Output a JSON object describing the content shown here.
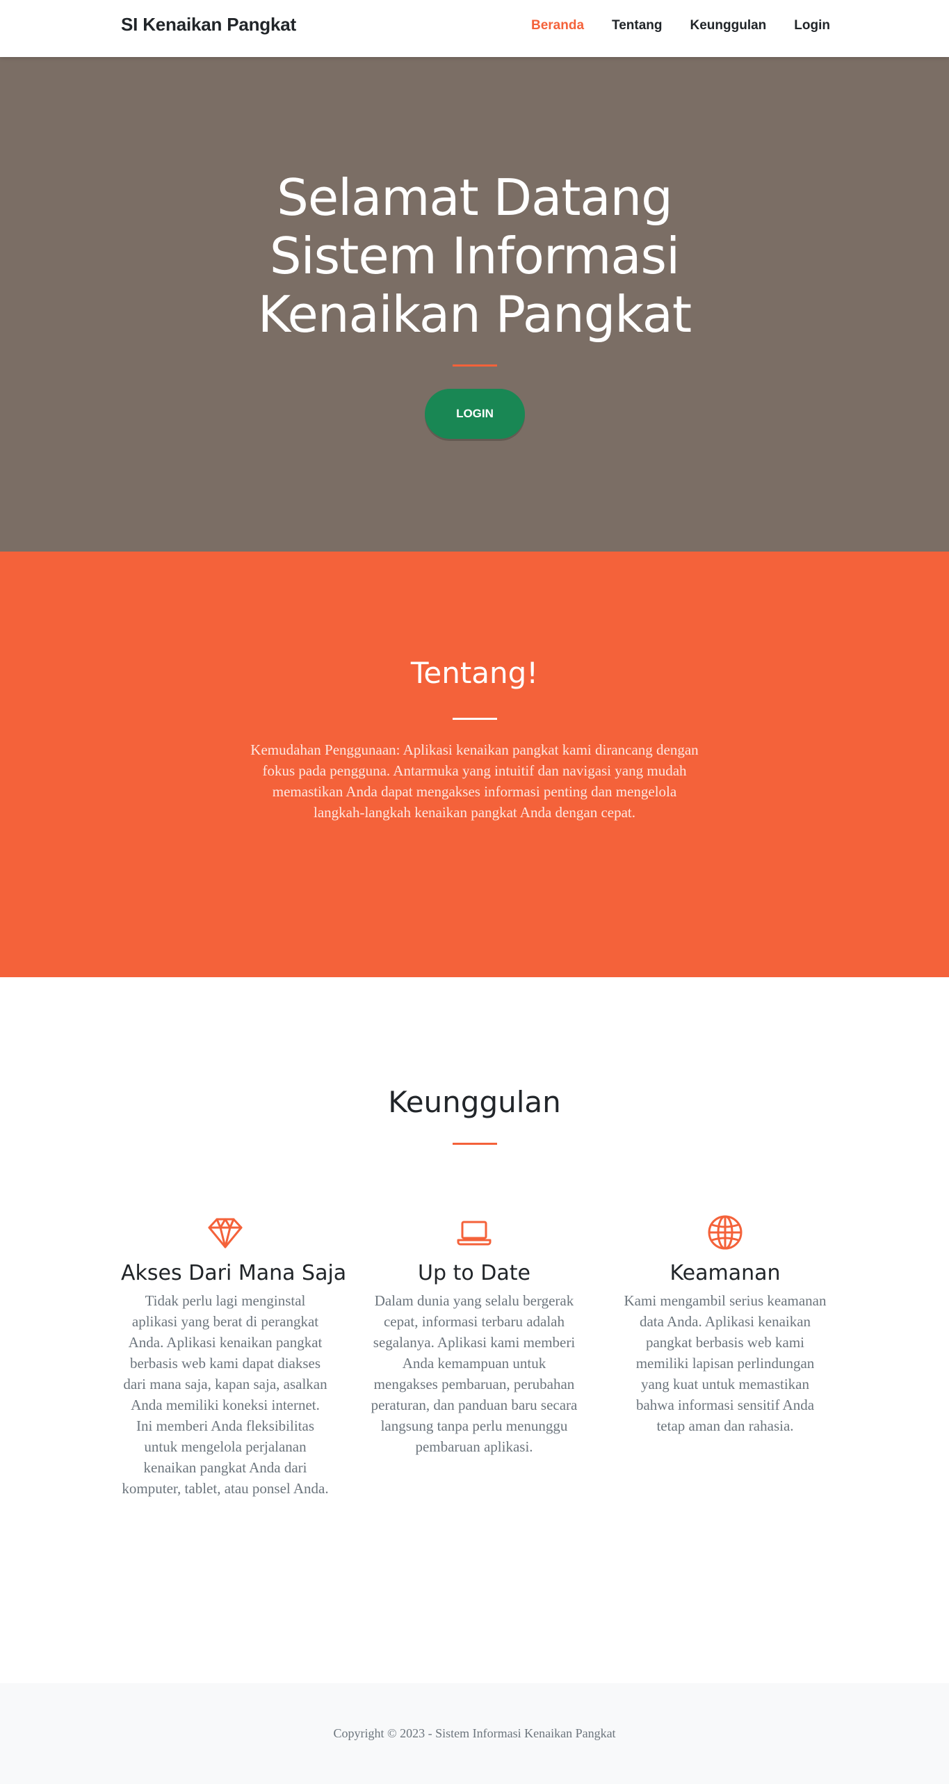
{
  "navbar": {
    "brand": "SI Kenaikan Pangkat",
    "links": [
      {
        "label": "Beranda",
        "active": true
      },
      {
        "label": "Tentang",
        "active": false
      },
      {
        "label": "Keunggulan",
        "active": false
      },
      {
        "label": "Login",
        "active": false
      }
    ]
  },
  "hero": {
    "title_lines": [
      "Selamat Datang",
      "Sistem Informasi",
      "Kenaikan Pangkat"
    ],
    "button_label": "LOGIN"
  },
  "about": {
    "title": "Tentang!",
    "text": "Kemudahan Penggunaan: Aplikasi kenaikan pangkat kami dirancang dengan fokus pada pengguna. Antarmuka yang intuitif dan navigasi yang mudah memastikan Anda dapat mengakses informasi penting dan mengelola langkah-langkah kenaikan pangkat Anda dengan cepat."
  },
  "features": {
    "title": "Keunggulan",
    "items": [
      {
        "icon": "gem-icon",
        "title": "Akses Dari Mana Saja",
        "text": "Tidak perlu lagi menginstal aplikasi yang berat di perangkat Anda. Aplikasi kenaikan pangkat berbasis web kami dapat diakses dari mana saja, kapan saja, asalkan Anda memiliki koneksi internet. Ini memberi Anda fleksibilitas untuk mengelola perjalanan kenaikan pangkat Anda dari komputer, tablet, atau ponsel Anda."
      },
      {
        "icon": "laptop-icon",
        "title": "Up to Date",
        "text": "Dalam dunia yang selalu bergerak cepat, informasi terbaru adalah segalanya. Aplikasi kami memberi Anda kemampuan untuk mengakses pembaruan, perubahan peraturan, dan panduan baru secara langsung tanpa perlu menunggu pembaruan aplikasi."
      },
      {
        "icon": "globe-icon",
        "title": "Keamanan",
        "text": "Kami mengambil serius keamanan data Anda. Aplikasi kenaikan pangkat berbasis web kami memiliki lapisan perlindungan yang kuat untuk memastikan bahwa informasi sensitif Anda tetap aman dan rahasia."
      }
    ]
  },
  "footer": {
    "copyright": "Copyright © 2023 - Sistem Informasi Kenaikan Pangkat"
  },
  "colors": {
    "accent": "#f4623a",
    "hero_bg": "#7b6e65",
    "button": "#198754",
    "footer_bg": "#f8f9fa"
  }
}
